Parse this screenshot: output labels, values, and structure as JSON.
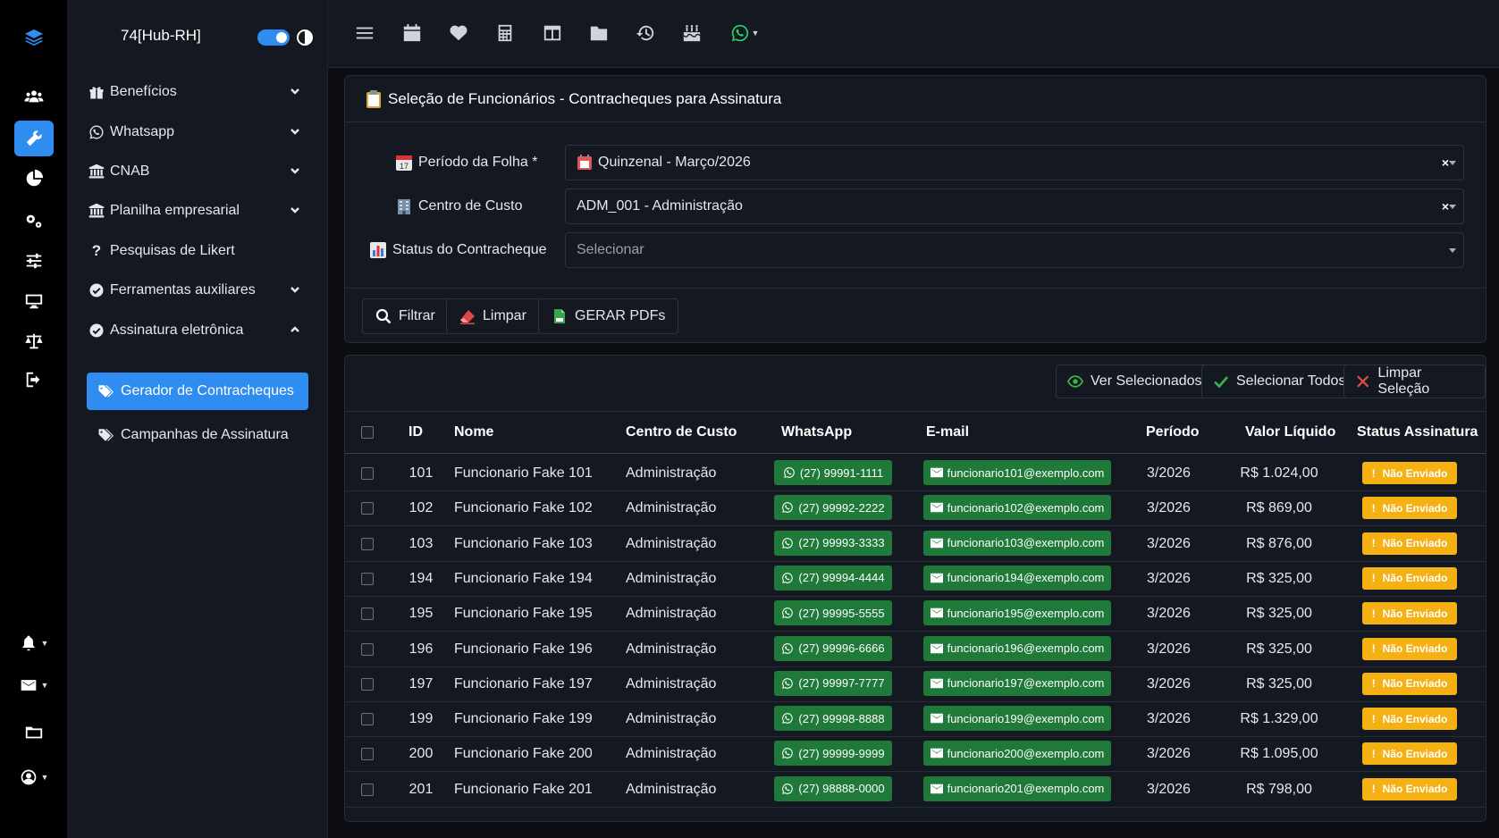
{
  "app": {
    "brand": "74[Hub-RH]"
  },
  "rail": {
    "icons": [
      "layers-logo-icon",
      "users-icon",
      "tools-icon",
      "chart-pie-icon",
      "cogs-icon",
      "sliders-icon",
      "desktop-icon",
      "balance-scale-icon",
      "sign-out-icon",
      "bell-icon",
      "envelope-icon",
      "folder-icon",
      "user-circle-icon"
    ]
  },
  "sidebar": {
    "items": [
      {
        "label": "Benefícios",
        "icon": "gift-icon",
        "expandable": true
      },
      {
        "label": "Whatsapp",
        "icon": "whatsapp-icon",
        "expandable": true
      },
      {
        "label": "CNAB",
        "icon": "bank-icon",
        "expandable": true
      },
      {
        "label": "Planilha empresarial",
        "icon": "bank-icon",
        "expandable": true
      },
      {
        "label": "Pesquisas de Likert",
        "icon": "question-icon",
        "expandable": false
      },
      {
        "label": "Ferramentas auxiliares",
        "icon": "check-circle-icon",
        "expandable": true
      },
      {
        "label": "Assinatura eletrônica",
        "icon": "check-circle-icon",
        "expandable": true,
        "expanded": true
      }
    ],
    "subitems": [
      {
        "label": "Gerador de Contracheques",
        "icon": "tags-icon",
        "active": true
      },
      {
        "label": "Campanhas de Assinatura",
        "icon": "tags-icon",
        "active": false
      }
    ]
  },
  "topbar": {
    "icons": [
      "menu-icon",
      "calendar-icon",
      "heart-icon",
      "calculator-icon",
      "columns-icon",
      "folder-icon",
      "history-icon",
      "birthday-cake-icon",
      "whatsapp-icon"
    ]
  },
  "filters": {
    "title": "Seleção de Funcionários - Contracheques para Assinatura",
    "periodo_label": "Período da Folha *",
    "periodo_value": "Quinzenal - Março/2026",
    "centro_label": "Centro de Custo",
    "centro_value": "ADM_001 - Administração",
    "status_label": "Status do Contracheque",
    "status_placeholder": "Selecionar",
    "clear_glyph": "×",
    "buttons": {
      "filtrar": "Filtrar",
      "limpar": "Limpar",
      "gerar": "GERAR PDFs"
    }
  },
  "table": {
    "actions": {
      "ver": "Ver Selecionados",
      "selecionar": "Selecionar Todos",
      "limpar": "Limpar Seleção"
    },
    "headers": {
      "id": "ID",
      "nome": "Nome",
      "centro": "Centro de Custo",
      "whatsapp": "WhatsApp",
      "email": "E-mail",
      "periodo": "Período",
      "valor": "Valor Líquido",
      "status": "Status Assinatura"
    },
    "status_glyph": "!",
    "rows": [
      {
        "id": "101",
        "nome": "Funcionario Fake 101",
        "centro": "Administração",
        "whatsapp": "(27) 99991-1111",
        "email": "funcionario101@exemplo.com",
        "periodo": "3/2026",
        "valor": "R$ 1.024,00",
        "status": "Não Enviado"
      },
      {
        "id": "102",
        "nome": "Funcionario Fake 102",
        "centro": "Administração",
        "whatsapp": "(27) 99992-2222",
        "email": "funcionario102@exemplo.com",
        "periodo": "3/2026",
        "valor": "R$ 869,00",
        "status": "Não Enviado"
      },
      {
        "id": "103",
        "nome": "Funcionario Fake 103",
        "centro": "Administração",
        "whatsapp": "(27) 99993-3333",
        "email": "funcionario103@exemplo.com",
        "periodo": "3/2026",
        "valor": "R$ 876,00",
        "status": "Não Enviado"
      },
      {
        "id": "194",
        "nome": "Funcionario Fake 194",
        "centro": "Administração",
        "whatsapp": "(27) 99994-4444",
        "email": "funcionario194@exemplo.com",
        "periodo": "3/2026",
        "valor": "R$ 325,00",
        "status": "Não Enviado"
      },
      {
        "id": "195",
        "nome": "Funcionario Fake 195",
        "centro": "Administração",
        "whatsapp": "(27) 99995-5555",
        "email": "funcionario195@exemplo.com",
        "periodo": "3/2026",
        "valor": "R$ 325,00",
        "status": "Não Enviado"
      },
      {
        "id": "196",
        "nome": "Funcionario Fake 196",
        "centro": "Administração",
        "whatsapp": "(27) 99996-6666",
        "email": "funcionario196@exemplo.com",
        "periodo": "3/2026",
        "valor": "R$ 325,00",
        "status": "Não Enviado"
      },
      {
        "id": "197",
        "nome": "Funcionario Fake 197",
        "centro": "Administração",
        "whatsapp": "(27) 99997-7777",
        "email": "funcionario197@exemplo.com",
        "periodo": "3/2026",
        "valor": "R$ 325,00",
        "status": "Não Enviado"
      },
      {
        "id": "199",
        "nome": "Funcionario Fake 199",
        "centro": "Administração",
        "whatsapp": "(27) 99998-8888",
        "email": "funcionario199@exemplo.com",
        "periodo": "3/2026",
        "valor": "R$ 1.329,00",
        "status": "Não Enviado"
      },
      {
        "id": "200",
        "nome": "Funcionario Fake 200",
        "centro": "Administração",
        "whatsapp": "(27) 99999-9999",
        "email": "funcionario200@exemplo.com",
        "periodo": "3/2026",
        "valor": "R$ 1.095,00",
        "status": "Não Enviado"
      },
      {
        "id": "201",
        "nome": "Funcionario Fake 201",
        "centro": "Administração",
        "whatsapp": "(27) 98888-0000",
        "email": "funcionario201@exemplo.com",
        "periodo": "3/2026",
        "valor": "R$ 798,00",
        "status": "Não Enviado"
      }
    ]
  },
  "colors": {
    "accent": "#2f8cf0",
    "success": "#1f7a3a",
    "warning": "#f5b014",
    "background": "#0b0d12",
    "panel": "#141821"
  }
}
